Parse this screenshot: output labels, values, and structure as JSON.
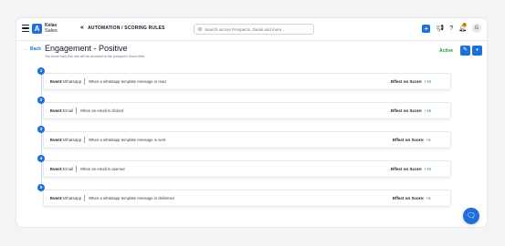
{
  "app": {
    "brand_name": "Kelas",
    "brand_sub": "Sales",
    "logo_glyph": "A",
    "brand_color": "#1e6fd9"
  },
  "header": {
    "breadcrumb": "AUTOMATION / SCORING RULES",
    "search_placeholder": "Search across Prospects, Deals and more...",
    "avatar_initial": "G",
    "notification_count": "8"
  },
  "page": {
    "back_label": "Back",
    "title": "Engagement - Positive",
    "subtitle": "The score from this rule will be recorded in the prospect's Score field",
    "status": "Active"
  },
  "rules": [
    {
      "step": "1",
      "event_label": "Event:",
      "event_type": "Whatsapp",
      "description": "When a whatsapp template message is read",
      "effect_label": "Effect on Score:",
      "effect_value": "+10"
    },
    {
      "step": "2",
      "event_label": "Event:",
      "event_type": "Email",
      "description": "When an email is clicked",
      "effect_label": "Effect on Score:",
      "effect_value": "+15"
    },
    {
      "step": "3",
      "event_label": "Event:",
      "event_type": "Whatsapp",
      "description": "When a whatsapp template message is sent",
      "effect_label": "Effect on Score:",
      "effect_value": "+5"
    },
    {
      "step": "4",
      "event_label": "Event:",
      "event_type": "Email",
      "description": "When an email is opened",
      "effect_label": "Effect on Score:",
      "effect_value": "+10"
    },
    {
      "step": "5",
      "event_label": "Event:",
      "event_type": "Whatsapp",
      "description": "When a whatsapp template message is delivered",
      "effect_label": "Effect on Score:",
      "effect_value": "+5"
    }
  ],
  "icons": {
    "menu": "hamburger-icon",
    "logo": "logo-icon",
    "breadcrumb": "double-chevron-left-icon",
    "search": "search-icon",
    "add": "plus-icon",
    "announce": "megaphone-icon",
    "help": "help-icon",
    "bell": "bell-icon",
    "edit": "pencil-icon",
    "more": "chevron-down-icon",
    "chat": "chat-icon"
  }
}
